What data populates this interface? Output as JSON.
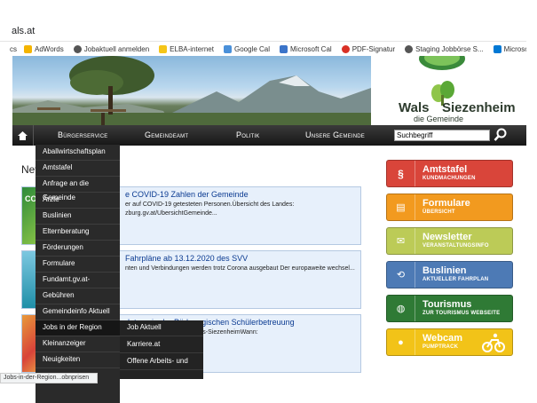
{
  "browser": {
    "address": "als.at",
    "bookmarks": [
      {
        "label": "cs",
        "color": "#ffffff"
      },
      {
        "label": "AdWords",
        "color": "#f4b400"
      },
      {
        "label": "Jobaktuell anmelden",
        "color": "#555555"
      },
      {
        "label": "ELBA-internet",
        "color": "#f5c518"
      },
      {
        "label": "Google Cal",
        "color": "#4a90d9"
      },
      {
        "label": "Microsoft Cal",
        "color": "#3b74c9"
      },
      {
        "label": "PDF-Signatur",
        "color": "#d93025"
      },
      {
        "label": "Staging Jobbörse S...",
        "color": "#555555"
      },
      {
        "label": "Microsoft e-mail",
        "color": "#0078d4"
      }
    ],
    "status_url": "Jobs-in-der-Region...obnprisen"
  },
  "logo": {
    "line1": "Wals",
    "line2": "Siezenheim",
    "tagline": "die Gemeinde"
  },
  "nav": {
    "items": [
      "Bürgerservice",
      "Gemeindeamt",
      "Politik",
      "Unsere Gemeinde"
    ],
    "search_value": "Suchbegriff"
  },
  "main": {
    "heading": "Nev",
    "cards": [
      {
        "title": "e COVID-19 Zahlen der Gemeinde",
        "text": "er auf COVID-19 getesteten Personen.Übersicht des Landes: zburg.gv.at/UbersichtGemeinde..."
      },
      {
        "title": "Fahrpläne ab 13.12.2020 des SVV",
        "text": "nten und Verbindungen werden trotz Corona ausgebaut Der europaweite wechsel..."
      },
      {
        "title": "detage in der Pädagogischen Schülerbetreuung",
        "text": "nder aus der Gemeinde Wals-SiezenheimWann:"
      }
    ]
  },
  "dropdown": {
    "items": [
      "Aballwirtschaftsplan",
      "Amtstafel",
      "Anfrage an die Gemeinde",
      "Ärzte",
      "Buslinien",
      "Elternberatung",
      "Förderungen",
      "Formulare",
      "Fundamt.gv.at-",
      "Gebühren",
      "Gemeindeinfo Aktuell",
      "Jobs in der Region",
      "Kleinanzeiger",
      "Neuigkeiten"
    ],
    "submenu": [
      "Job Aktuell",
      "Karriere.at",
      "Offene Arbeits- und"
    ]
  },
  "sidebar": {
    "buttons": [
      {
        "title": "Amtstafel",
        "sub": "KUNDMACHUNGEN",
        "color": "#d9453a",
        "icon": "§"
      },
      {
        "title": "Formulare",
        "sub": "ÜBERSICHT",
        "color": "#f29a1f",
        "icon": "▤"
      },
      {
        "title": "Newsletter",
        "sub": "VERANSTALTUNGSINFO",
        "color": "#bccb57",
        "icon": "✉"
      },
      {
        "title": "Buslinien",
        "sub": "AKTUELLER FAHRPLAN",
        "color": "#4d7ab5",
        "icon": "⟲"
      },
      {
        "title": "Tourismus",
        "sub": "ZUR TOURISMUS WEBSEITE",
        "color": "#2f7a35",
        "icon": "◍"
      },
      {
        "title": "Webcam",
        "sub": "PUMPTRACK",
        "color": "#f2c318",
        "icon": "●"
      }
    ]
  }
}
